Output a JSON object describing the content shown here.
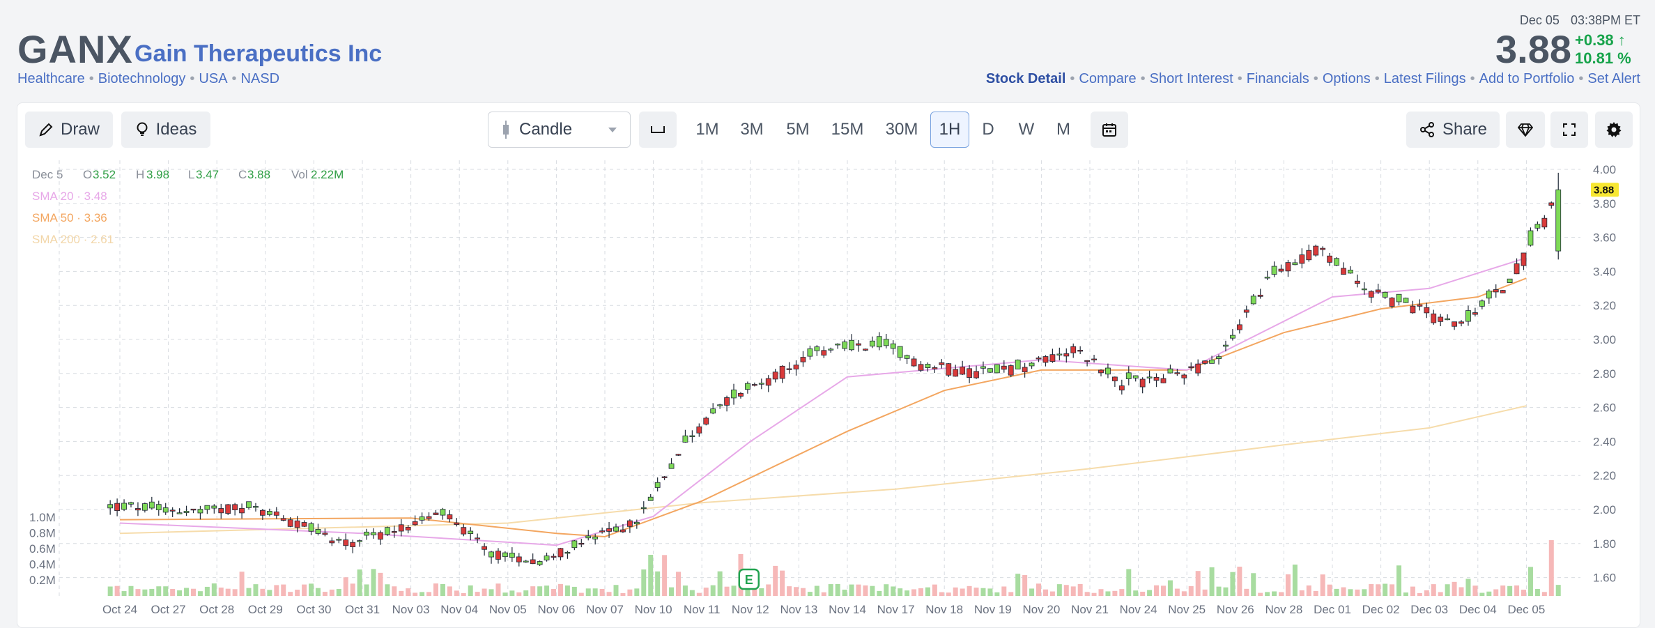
{
  "header": {
    "ticker": "GANX",
    "company": "Gain Therapeutics Inc",
    "crumbs": [
      "Healthcare",
      "Biotechnology",
      "USA",
      "NASD"
    ],
    "quote_date": "Dec 05",
    "quote_time": "03:38PM ET",
    "price": "3.88",
    "change": "+0.38",
    "change_pct": "10.81 %",
    "nav": [
      "Stock Detail",
      "Compare",
      "Short Interest",
      "Financials",
      "Options",
      "Latest Filings",
      "Add to Portfolio",
      "Set Alert"
    ]
  },
  "toolbar": {
    "draw": "Draw",
    "ideas": "Ideas",
    "chart_type": "Candle",
    "timeframes": [
      "1M",
      "3M",
      "5M",
      "15M",
      "30M",
      "1H",
      "D",
      "W",
      "M"
    ],
    "active_timeframe": "1H",
    "share": "Share"
  },
  "legend": {
    "date": "Dec 5",
    "o_label": "O",
    "o": "3.52",
    "h_label": "H",
    "h": "3.98",
    "l_label": "L",
    "l": "3.47",
    "c_label": "C",
    "c": "3.88",
    "vol_label": "Vol",
    "vol": "2.22M",
    "sma20": "SMA 20 · 3.48",
    "sma50": "SMA 50 · 3.36",
    "sma200": "SMA 200 · 2.61"
  },
  "colors": {
    "up": "#7ed957",
    "down": "#d93a3a",
    "sma20": "#e7a8e8",
    "sma50": "#f3a660",
    "sma200": "#f6dcab",
    "vol_up": "#a8dca0",
    "vol_down": "#f6b8b8",
    "price_label_bg": "#f7e733"
  },
  "chart_data": {
    "type": "candlestick",
    "x_labels": [
      "Oct 24",
      "Oct 27",
      "Oct 28",
      "Oct 29",
      "Oct 30",
      "Oct 31",
      "Nov 03",
      "Nov 04",
      "Nov 05",
      "Nov 06",
      "Nov 07",
      "Nov 10",
      "Nov 11",
      "Nov 12",
      "Nov 13",
      "Nov 14",
      "Nov 17",
      "Nov 18",
      "Nov 19",
      "Nov 20",
      "Nov 21",
      "Nov 24",
      "Nov 25",
      "Nov 26",
      "Nov 28",
      "Dec 01",
      "Dec 02",
      "Dec 03",
      "Dec 04",
      "Dec 05"
    ],
    "y_ticks": [
      "1.60",
      "1.80",
      "2.00",
      "2.20",
      "2.40",
      "2.60",
      "2.80",
      "3.00",
      "3.20",
      "3.40",
      "3.60",
      "3.80",
      "4.00"
    ],
    "ylim": [
      1.5,
      4.0
    ],
    "vol_ticks": [
      "0.2M",
      "0.4M",
      "0.6M",
      "0.8M",
      "1.0M"
    ],
    "last_price_label": "3.88",
    "earnings_marker": "E",
    "earnings_date": "Nov 12",
    "daily_closes": [
      2.01,
      1.99,
      2.02,
      1.92,
      1.8,
      1.88,
      1.98,
      1.74,
      1.7,
      1.82,
      1.93,
      2.4,
      2.68,
      2.82,
      2.95,
      2.97,
      2.85,
      2.82,
      2.84,
      2.95,
      2.75,
      2.78,
      2.9,
      3.35,
      3.55,
      3.3,
      3.2,
      3.08,
      3.35,
      3.88
    ],
    "sma20_points": [
      [
        0,
        1.92
      ],
      [
        5,
        1.86
      ],
      [
        9,
        1.79
      ],
      [
        11,
        1.96
      ],
      [
        13,
        2.4
      ],
      [
        15,
        2.78
      ],
      [
        19,
        2.88
      ],
      [
        22,
        2.82
      ],
      [
        25,
        3.25
      ],
      [
        27,
        3.3
      ],
      [
        29,
        3.48
      ]
    ],
    "sma50_points": [
      [
        0,
        1.94
      ],
      [
        6,
        1.95
      ],
      [
        9,
        1.86
      ],
      [
        10,
        1.84
      ],
      [
        12,
        2.05
      ],
      [
        15,
        2.46
      ],
      [
        17,
        2.7
      ],
      [
        19,
        2.82
      ],
      [
        22,
        2.82
      ],
      [
        24,
        3.04
      ],
      [
        26,
        3.18
      ],
      [
        28,
        3.25
      ],
      [
        29,
        3.36
      ]
    ],
    "sma200_points": [
      [
        0,
        1.86
      ],
      [
        8,
        1.92
      ],
      [
        12,
        2.04
      ],
      [
        16,
        2.12
      ],
      [
        20,
        2.24
      ],
      [
        24,
        2.38
      ],
      [
        27,
        2.48
      ],
      [
        29,
        2.61
      ]
    ],
    "last_candle": {
      "o": 3.52,
      "h": 3.98,
      "l": 3.47,
      "c": 3.88
    }
  }
}
